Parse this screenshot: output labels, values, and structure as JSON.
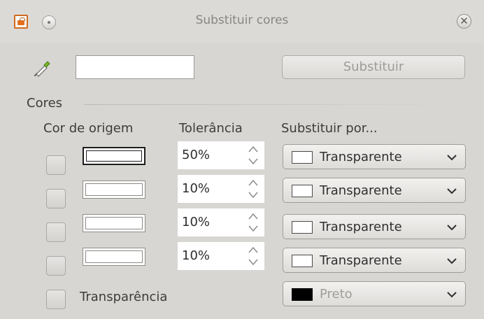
{
  "window": {
    "title": "Substituir cores"
  },
  "top": {
    "replace_button": "Substituir"
  },
  "section": {
    "label": "Cores"
  },
  "headers": {
    "source": "Cor de origem",
    "tolerance": "Tolerância",
    "replace_with": "Substituir por..."
  },
  "rows": [
    {
      "tolerance": "50%",
      "replace_with": "Transparente",
      "selected": true
    },
    {
      "tolerance": "10%",
      "replace_with": "Transparente",
      "selected": false
    },
    {
      "tolerance": "10%",
      "replace_with": "Transparente",
      "selected": false
    },
    {
      "tolerance": "10%",
      "replace_with": "Transparente",
      "selected": false
    }
  ],
  "transparency": {
    "label": "Transparência",
    "color_label": "Preto",
    "color": "#000000"
  },
  "icons": {
    "app": "app-icon",
    "menu": "menu-icon",
    "close": "close-icon",
    "pipette": "pipette-icon"
  }
}
